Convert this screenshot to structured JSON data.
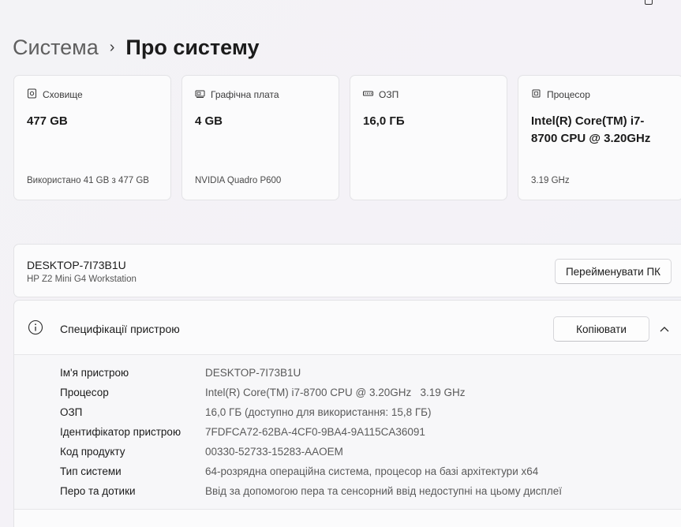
{
  "breadcrumb": {
    "parent": "Система",
    "separator": "›",
    "current": "Про систему"
  },
  "cards": [
    {
      "icon": "storage-icon",
      "label": "Сховище",
      "value": "477 GB",
      "sub": "Використано 41 GB з 477 GB"
    },
    {
      "icon": "graphics-card-icon",
      "label": "Графічна плата",
      "value": "4 GB",
      "sub": "NVIDIA Quadro P600"
    },
    {
      "icon": "ram-icon",
      "label": "ОЗП",
      "value": "16,0 ГБ",
      "sub": ""
    },
    {
      "icon": "processor-icon",
      "label": "Процесор",
      "value": "Intel(R) Core(TM) i7-8700 CPU @ 3.20GHz",
      "sub": "3.19 GHz"
    }
  ],
  "device": {
    "name": "DESKTOP-7I73B1U",
    "model": "HP Z2 Mini G4 Workstation",
    "rename_label": "Перейменувати ПК"
  },
  "specs": {
    "title": "Специфікації пристрою",
    "copy_label": "Копіювати",
    "rows": [
      {
        "label": "Ім'я пристрою",
        "value": "DESKTOP-7I73B1U"
      },
      {
        "label": "Процесор",
        "value": "Intel(R) Core(TM) i7-8700 CPU @ 3.20GHz   3.19 GHz"
      },
      {
        "label": "ОЗП",
        "value": "16,0 ГБ (доступно для використання: 15,8 ГБ)"
      },
      {
        "label": "Ідентифікатор пристрою",
        "value": "7FDFCA72-62BA-4CF0-9BA4-9A115CA36091"
      },
      {
        "label": "Код продукту",
        "value": "00330-52733-15283-AAOEM"
      },
      {
        "label": "Тип системи",
        "value": "64-розрядна операційна система, процесор на базі архітектури x64"
      },
      {
        "label": "Перо та дотики",
        "value": "Ввід за допомогою пера та сенсорний ввід недоступні на цьому дисплеї"
      }
    ]
  },
  "colors": {
    "accent": "#0a5fb4",
    "background": "#f3f3f6",
    "card": "#fbfbfc"
  }
}
